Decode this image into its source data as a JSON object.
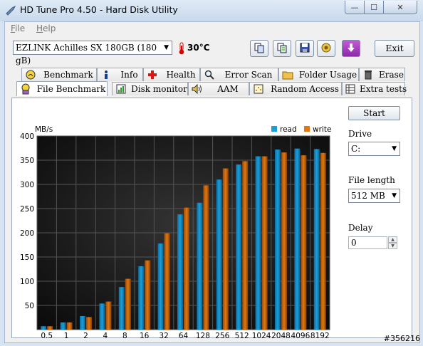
{
  "window": {
    "title": "HD Tune Pro 4.50 - Hard Disk Utility",
    "minimize": "—",
    "maximize": "☐",
    "close": "✕"
  },
  "menu": [
    {
      "mnemonic": "F",
      "rest": "ile"
    },
    {
      "mnemonic": "H",
      "rest": "elp"
    }
  ],
  "toolbar": {
    "drive": "EZLINK Achilles SX 180GB (180 gB)",
    "temperature": "30°C",
    "exit_label": "Exit",
    "icons": [
      "copy-icon",
      "copy-text-icon",
      "save-icon",
      "screenshot-icon",
      "download-icon"
    ]
  },
  "tabs_row1": [
    "Benchmark",
    "Info",
    "Health",
    "Error Scan",
    "Folder Usage",
    "Erase"
  ],
  "tabs_row2": [
    "File Benchmark",
    "Disk monitor",
    "AAM",
    "Random Access",
    "Extra tests"
  ],
  "controls": {
    "start_label": "Start",
    "drive_label": "Drive",
    "drive_value": "C:",
    "file_length_label": "File length",
    "file_length_value": "512 MB",
    "delay_label": "Delay",
    "delay_value": "0"
  },
  "watermark": "#356216",
  "colors": {
    "read": "#1a9fd8",
    "write": "#e07810",
    "plot_bg": "#1a1a1a"
  },
  "chart_data": {
    "type": "bar",
    "ylabel": "MB/s",
    "ylim": [
      0,
      400
    ],
    "yticks": [
      50,
      100,
      150,
      200,
      250,
      300,
      350,
      400
    ],
    "categories": [
      "0.5",
      "1",
      "2",
      "4",
      "8",
      "16",
      "32",
      "64",
      "128",
      "256",
      "512",
      "1024",
      "2048",
      "4096",
      "8192"
    ],
    "legend_position": "top-right",
    "series": [
      {
        "name": "read",
        "values": [
          7,
          15,
          28,
          54,
          88,
          131,
          178,
          238,
          262,
          310,
          341,
          358,
          372,
          374,
          373
        ]
      },
      {
        "name": "write",
        "values": [
          7,
          15,
          26,
          58,
          105,
          143,
          199,
          252,
          298,
          333,
          348,
          358,
          366,
          360,
          365
        ]
      }
    ]
  }
}
